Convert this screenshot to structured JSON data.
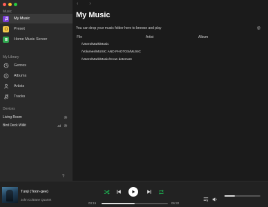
{
  "colors": {
    "accent_green": "#1db954",
    "my_music_icon_bg": "#7a3fd6",
    "preset_icon_bg": "#f2c94c",
    "home_server_icon_bg": "#2fa84f",
    "sidebar_bg": "#2a2a2a",
    "main_bg": "#1b1b1b"
  },
  "sidebar": {
    "music_section_label": "Music",
    "nav_items": [
      {
        "label": "My Music",
        "icon": "music-note-icon",
        "active": true
      },
      {
        "label": "Preset",
        "icon": "preset-icon",
        "active": false
      },
      {
        "label": "Home Music Server",
        "icon": "server-icon",
        "active": false
      }
    ],
    "library_section_label": "My Library",
    "library_items": [
      {
        "label": "Genres",
        "icon": "genres-icon"
      },
      {
        "label": "Albums",
        "icon": "album-icon"
      },
      {
        "label": "Artists",
        "icon": "artist-icon"
      },
      {
        "label": "Tracks",
        "icon": "tracks-icon"
      }
    ],
    "devices_section_label": "Devices",
    "devices": [
      {
        "name": "Living Room",
        "badge": ""
      },
      {
        "name": "Bird Deck Willit",
        "badge": "Jd"
      }
    ],
    "help_label": "?"
  },
  "main": {
    "back_arrow": "‹",
    "forward_arrow": "›",
    "title": "My Music",
    "drop_hint": "You can drop your music folder here to browse and play",
    "columns": {
      "file": "File",
      "artist": "Artist",
      "album": "Album"
    },
    "folders": [
      "/Users/Mark/Music",
      "/Volumes/MUSIC AND PHOTOS/MUSIC",
      "/Users/Mark/Music/Crow deterrant"
    ]
  },
  "player": {
    "track_title": "Tunji (Toon-gee)",
    "artist": "John Coltrane Quartet",
    "elapsed": "03:15",
    "total": "06:32",
    "progress": 0.5,
    "volume": 0.28,
    "controls": [
      "shuffle-icon",
      "previous-icon",
      "play-icon",
      "next-icon",
      "repeat-icon",
      "queue-icon",
      "volume-icon"
    ]
  }
}
